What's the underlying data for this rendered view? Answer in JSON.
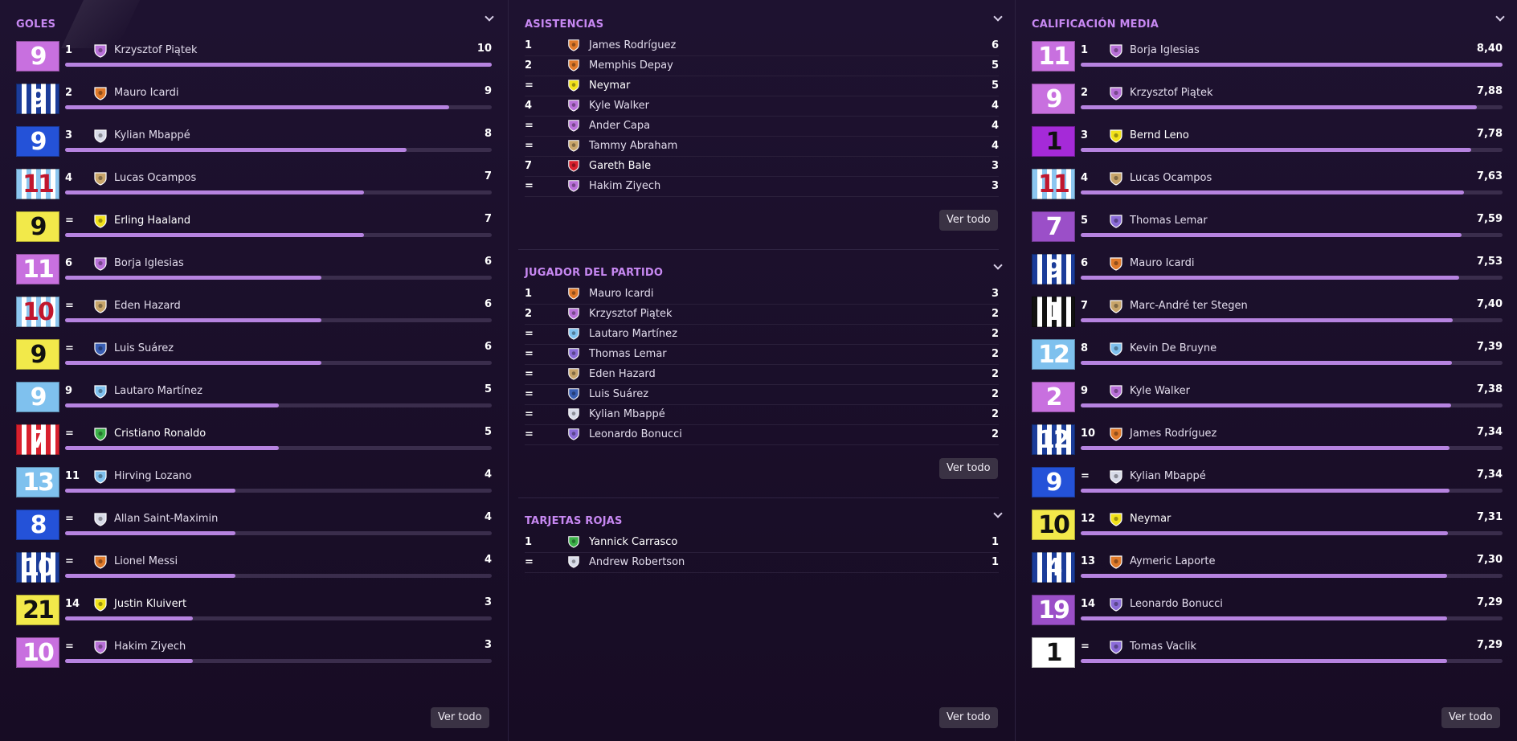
{
  "goles": {
    "title": "GOLES",
    "ver_todo": "Ver todo",
    "rows": [
      {
        "rank": "1",
        "name": "Krzysztof Piątek",
        "value": "10",
        "num": 10,
        "shirt": "9",
        "kit": [
          "#c870df",
          "#c870df"
        ],
        "digit": "#fff",
        "crest": "#b870d8",
        "hl": false
      },
      {
        "rank": "2",
        "name": "Mauro Icardi",
        "value": "9",
        "num": 9,
        "shirt": "9",
        "kit": [
          "#1b3c99",
          "#ffffff"
        ],
        "digit": "#fff",
        "crest": "#e07a2a",
        "hl": false
      },
      {
        "rank": "3",
        "name": "Kylian Mbappé",
        "value": "8",
        "num": 8,
        "shirt": "9",
        "kit": [
          "#2452d8",
          "#2452d8"
        ],
        "digit": "#fff",
        "crest": "#d8dbe8",
        "hl": false
      },
      {
        "rank": "4",
        "name": "Lucas Ocampos",
        "value": "7",
        "num": 7,
        "shirt": "11",
        "kit": [
          "#8cc6f0",
          "#ffffff"
        ],
        "digit": "#c0162e",
        "crest": "#c8a56a",
        "hl": false
      },
      {
        "rank": "=",
        "name": "Erling Haaland",
        "value": "7",
        "num": 7,
        "shirt": "9",
        "kit": [
          "#f2e94a",
          "#f2e94a"
        ],
        "digit": "#111",
        "crest": "#f2e21a",
        "hl": true
      },
      {
        "rank": "6",
        "name": "Borja Iglesias",
        "value": "6",
        "num": 6,
        "shirt": "11",
        "kit": [
          "#c870df",
          "#c870df"
        ],
        "digit": "#fff",
        "crest": "#b870d8",
        "hl": false
      },
      {
        "rank": "=",
        "name": "Eden Hazard",
        "value": "6",
        "num": 6,
        "shirt": "10",
        "kit": [
          "#8cc6f0",
          "#ffffff"
        ],
        "digit": "#c0162e",
        "crest": "#c8a56a",
        "hl": false
      },
      {
        "rank": "=",
        "name": "Luis Suárez",
        "value": "6",
        "num": 6,
        "shirt": "9",
        "kit": [
          "#f2e94a",
          "#f2e94a"
        ],
        "digit": "#111",
        "crest": "#3a5fb5",
        "hl": false
      },
      {
        "rank": "9",
        "name": "Lautaro Martínez",
        "value": "5",
        "num": 5,
        "shirt": "9",
        "kit": [
          "#7fc1ee",
          "#7fc1ee"
        ],
        "digit": "#fff",
        "crest": "#7fc1ee",
        "hl": false
      },
      {
        "rank": "=",
        "name": "Cristiano Ronaldo",
        "value": "5",
        "num": 5,
        "shirt": "7",
        "kit": [
          "#d8202e",
          "#ffffff"
        ],
        "digit": "#fff",
        "crest": "#3db24a",
        "hl": true
      },
      {
        "rank": "11",
        "name": "Hirving Lozano",
        "value": "4",
        "num": 4,
        "shirt": "13",
        "kit": [
          "#7fc1ee",
          "#7fc1ee"
        ],
        "digit": "#fff",
        "crest": "#7fc1ee",
        "hl": false
      },
      {
        "rank": "=",
        "name": "Allan Saint-Maximin",
        "value": "4",
        "num": 4,
        "shirt": "8",
        "kit": [
          "#2452d8",
          "#2452d8"
        ],
        "digit": "#fff",
        "crest": "#d8dbe8",
        "hl": false
      },
      {
        "rank": "=",
        "name": "Lionel Messi",
        "value": "4",
        "num": 4,
        "shirt": "10",
        "kit": [
          "#1b3c99",
          "#ffffff"
        ],
        "digit": "#fff",
        "crest": "#e07a2a",
        "hl": false
      },
      {
        "rank": "14",
        "name": "Justin Kluivert",
        "value": "3",
        "num": 3,
        "shirt": "21",
        "kit": [
          "#f2e94a",
          "#f2e94a"
        ],
        "digit": "#111",
        "crest": "#f2e21a",
        "hl": true
      },
      {
        "rank": "=",
        "name": "Hakim Ziyech",
        "value": "3",
        "num": 3,
        "shirt": "10",
        "kit": [
          "#c870df",
          "#c870df"
        ],
        "digit": "#fff",
        "crest": "#b870d8",
        "hl": false
      }
    ]
  },
  "asistencias": {
    "title": "ASISTENCIAS",
    "ver_todo": "Ver todo",
    "rows": [
      {
        "rank": "1",
        "name": "James Rodríguez",
        "value": "6",
        "crest": "#e07a2a",
        "hl": false
      },
      {
        "rank": "2",
        "name": "Memphis Depay",
        "value": "5",
        "crest": "#e07a2a",
        "hl": false
      },
      {
        "rank": "=",
        "name": "Neymar",
        "value": "5",
        "crest": "#f2e21a",
        "hl": true
      },
      {
        "rank": "4",
        "name": "Kyle Walker",
        "value": "4",
        "crest": "#b870d8",
        "hl": false
      },
      {
        "rank": "=",
        "name": "Ander Capa",
        "value": "4",
        "crest": "#b870d8",
        "hl": false
      },
      {
        "rank": "=",
        "name": "Tammy Abraham",
        "value": "4",
        "crest": "#c8a56a",
        "hl": false
      },
      {
        "rank": "7",
        "name": "Gareth Bale",
        "value": "3",
        "crest": "#d8202e",
        "hl": true
      },
      {
        "rank": "=",
        "name": "Hakim Ziyech",
        "value": "3",
        "crest": "#b870d8",
        "hl": false
      }
    ]
  },
  "jugador_partido": {
    "title": "JUGADOR DEL PARTIDO",
    "ver_todo": "Ver todo",
    "rows": [
      {
        "rank": "1",
        "name": "Mauro Icardi",
        "value": "3",
        "crest": "#e07a2a",
        "hl": false
      },
      {
        "rank": "2",
        "name": "Krzysztof Piątek",
        "value": "2",
        "crest": "#b870d8",
        "hl": false
      },
      {
        "rank": "=",
        "name": "Lautaro Martínez",
        "value": "2",
        "crest": "#7fc1ee",
        "hl": false
      },
      {
        "rank": "=",
        "name": "Thomas Lemar",
        "value": "2",
        "crest": "#8b6cd8",
        "hl": false
      },
      {
        "rank": "=",
        "name": "Eden Hazard",
        "value": "2",
        "crest": "#c8a56a",
        "hl": false
      },
      {
        "rank": "=",
        "name": "Luis Suárez",
        "value": "2",
        "crest": "#3a5fb5",
        "hl": false
      },
      {
        "rank": "=",
        "name": "Kylian Mbappé",
        "value": "2",
        "crest": "#d8dbe8",
        "hl": false
      },
      {
        "rank": "=",
        "name": "Leonardo Bonucci",
        "value": "2",
        "crest": "#8b6cd8",
        "hl": false
      }
    ]
  },
  "tarjetas_rojas": {
    "title": "TARJETAS ROJAS",
    "ver_todo": "Ver todo",
    "rows": [
      {
        "rank": "1",
        "name": "Yannick Carrasco",
        "value": "1",
        "crest": "#3db24a",
        "hl": true
      },
      {
        "rank": "=",
        "name": "Andrew Robertson",
        "value": "1",
        "crest": "#d8dbe8",
        "hl": false
      }
    ]
  },
  "calificacion": {
    "title": "CALIFICACIÓN MEDIA",
    "ver_todo": "Ver todo",
    "rows": [
      {
        "rank": "1",
        "name": "Borja Iglesias",
        "value": "8,40",
        "num": 8.4,
        "shirt": "11",
        "kit": [
          "#c870df",
          "#c870df"
        ],
        "digit": "#fff",
        "crest": "#b870d8",
        "hl": false
      },
      {
        "rank": "2",
        "name": "Krzysztof Piątek",
        "value": "7,88",
        "num": 7.88,
        "shirt": "9",
        "kit": [
          "#c870df",
          "#c870df"
        ],
        "digit": "#fff",
        "crest": "#b870d8",
        "hl": false
      },
      {
        "rank": "3",
        "name": "Bernd Leno",
        "value": "7,78",
        "num": 7.78,
        "shirt": "1",
        "kit": [
          "#a52ad8",
          "#a52ad8"
        ],
        "digit": "#111",
        "crest": "#f2e21a",
        "hl": true
      },
      {
        "rank": "4",
        "name": "Lucas Ocampos",
        "value": "7,63",
        "num": 7.63,
        "shirt": "11",
        "kit": [
          "#8cc6f0",
          "#ffffff"
        ],
        "digit": "#c0162e",
        "crest": "#c8a56a",
        "hl": false
      },
      {
        "rank": "5",
        "name": "Thomas Lemar",
        "value": "7,59",
        "num": 7.59,
        "shirt": "7",
        "kit": [
          "#9b4fc8",
          "#9b4fc8"
        ],
        "digit": "#fff",
        "crest": "#8b6cd8",
        "hl": false
      },
      {
        "rank": "6",
        "name": "Mauro Icardi",
        "value": "7,53",
        "num": 7.53,
        "shirt": "9",
        "kit": [
          "#1b3c99",
          "#ffffff"
        ],
        "digit": "#fff",
        "crest": "#e07a2a",
        "hl": false
      },
      {
        "rank": "7",
        "name": "Marc-André ter Stegen",
        "value": "7,40",
        "num": 7.4,
        "shirt": "1",
        "kit": [
          "#111111",
          "#ffffff"
        ],
        "digit": "#fff",
        "crest": "#c8a56a",
        "hl": false
      },
      {
        "rank": "8",
        "name": "Kevin De Bruyne",
        "value": "7,39",
        "num": 7.39,
        "shirt": "12",
        "kit": [
          "#7fc1ee",
          "#7fc1ee"
        ],
        "digit": "#fff",
        "crest": "#7fc1ee",
        "hl": false
      },
      {
        "rank": "9",
        "name": "Kyle Walker",
        "value": "7,38",
        "num": 7.38,
        "shirt": "2",
        "kit": [
          "#c870df",
          "#c870df"
        ],
        "digit": "#fff",
        "crest": "#b870d8",
        "hl": false
      },
      {
        "rank": "10",
        "name": "James Rodríguez",
        "value": "7,34",
        "num": 7.34,
        "shirt": "12",
        "kit": [
          "#1b3c99",
          "#ffffff"
        ],
        "digit": "#fff",
        "crest": "#e07a2a",
        "hl": false
      },
      {
        "rank": "=",
        "name": "Kylian Mbappé",
        "value": "7,34",
        "num": 7.34,
        "shirt": "9",
        "kit": [
          "#2452d8",
          "#2452d8"
        ],
        "digit": "#fff",
        "crest": "#d8dbe8",
        "hl": false
      },
      {
        "rank": "12",
        "name": "Neymar",
        "value": "7,31",
        "num": 7.31,
        "shirt": "10",
        "kit": [
          "#f2e94a",
          "#f2e94a"
        ],
        "digit": "#111",
        "crest": "#f2e21a",
        "hl": true
      },
      {
        "rank": "13",
        "name": "Aymeric Laporte",
        "value": "7,30",
        "num": 7.3,
        "shirt": "4",
        "kit": [
          "#1b3c99",
          "#ffffff"
        ],
        "digit": "#fff",
        "crest": "#e07a2a",
        "hl": false
      },
      {
        "rank": "14",
        "name": "Leonardo Bonucci",
        "value": "7,29",
        "num": 7.29,
        "shirt": "19",
        "kit": [
          "#9b4fc8",
          "#9b4fc8"
        ],
        "digit": "#fff",
        "crest": "#8b6cd8",
        "hl": false
      },
      {
        "rank": "=",
        "name": "Tomas Vaclik",
        "value": "7,29",
        "num": 7.29,
        "shirt": "1",
        "kit": [
          "#ffffff",
          "#ffffff"
        ],
        "digit": "#111",
        "crest": "#8b6cd8",
        "hl": false
      }
    ]
  }
}
